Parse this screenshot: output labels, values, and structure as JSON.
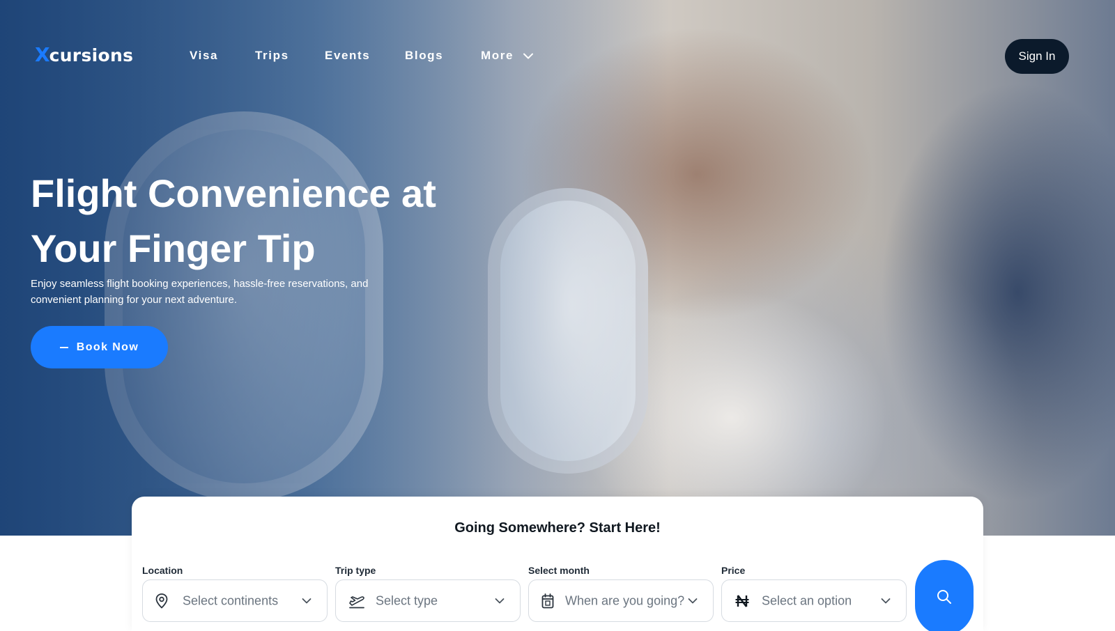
{
  "brand": {
    "logo_x": "X",
    "logo_rest": "cursions"
  },
  "nav": {
    "items": [
      {
        "label": "Visa"
      },
      {
        "label": "Trips"
      },
      {
        "label": "Events"
      },
      {
        "label": "Blogs"
      },
      {
        "label": "More",
        "icon": "chevron-down-icon"
      }
    ],
    "signin_label": "Sign In"
  },
  "hero": {
    "headline": "Flight Convenience at Your Finger Tip",
    "subtitle": "Enjoy seamless flight booking experiences, hassle-free reservations, and convenient planning for your next adventure.",
    "cta_label": "Book Now"
  },
  "search": {
    "title": "Going Somewhere? Start Here!",
    "fields": [
      {
        "label": "Location",
        "placeholder": "Select continents",
        "icon": "location-pin-icon"
      },
      {
        "label": "Trip type",
        "placeholder": "Select type",
        "icon": "airplane-departure-icon"
      },
      {
        "label": "Select month",
        "placeholder": "When are you going?",
        "icon": "calendar-icon"
      },
      {
        "label": "Price",
        "placeholder": "Select an option",
        "icon": "naira-icon"
      }
    ],
    "button_icon": "search-icon"
  },
  "colors": {
    "accent": "#1a7bff",
    "dark_button": "#0b1a2b",
    "text_dark": "#101820",
    "placeholder": "#6b7580",
    "border": "#d6dbe1"
  }
}
